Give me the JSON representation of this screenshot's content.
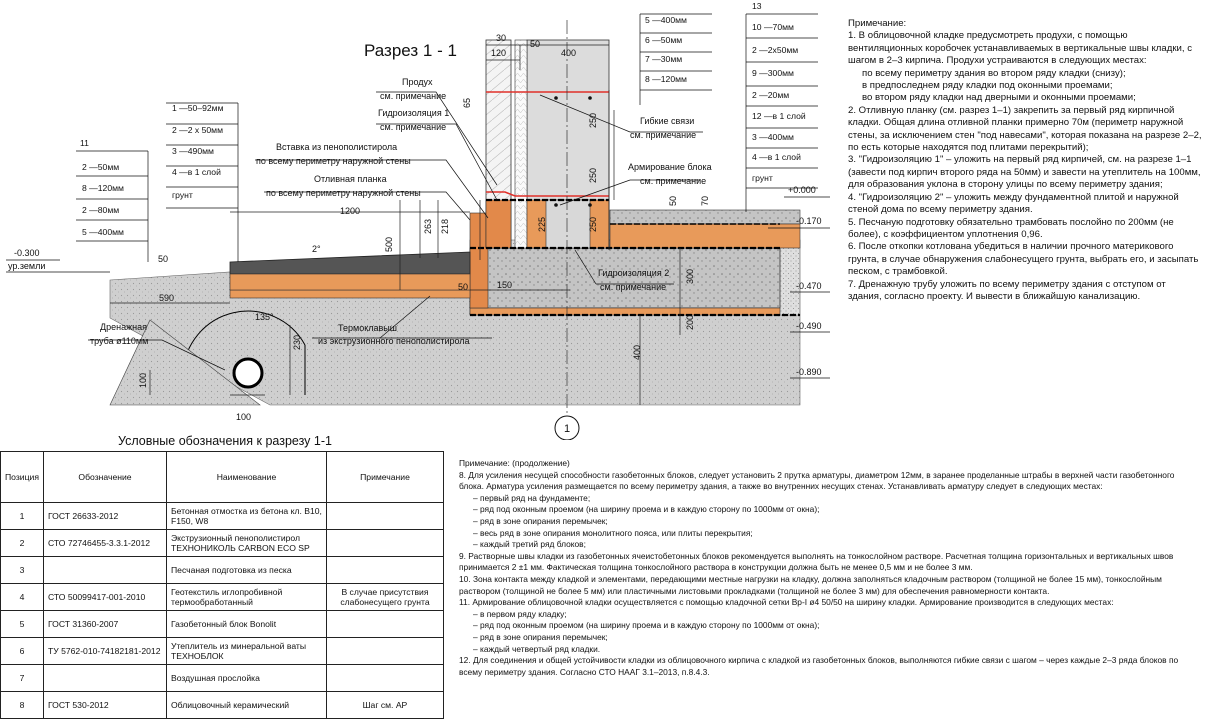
{
  "title": "Разрез 1 - 1",
  "axis_marker": "1",
  "layer_tables": {
    "left_top": [
      "1 —50–92мм",
      "2 —2 х 50мм",
      "3 —490мм",
      "4 —в 1 слой",
      "грунт"
    ],
    "left_num": "11",
    "left_bottom": [
      "2 —50мм",
      "8 —120мм",
      "2 —80мм",
      "5 —400мм"
    ],
    "top_center": [
      "5 —400мм",
      "6 —50мм",
      "7 —30мм",
      "8 —120мм"
    ],
    "right_num": "13",
    "right": [
      "10 —70мм",
      "2 —2х50мм",
      "9 —300мм",
      "2 —20мм",
      "12 —в 1 слой",
      "3 —400мм",
      "4 —в 1 слой",
      "грунт"
    ]
  },
  "elevations": {
    "ground": "-0.300",
    "ground_label": "ур.земли",
    "zero": "+0.000",
    "e170": "-0.170",
    "e470": "-0.470",
    "e490": "-0.490",
    "e890": "-0.890"
  },
  "callouts": {
    "produh": "Продух",
    "produh_sub": "см. примечание",
    "hydro1": "Гидроизоляция 1",
    "hydro1_sub": "см. примечание",
    "insert": "Вставка из пенополистирола",
    "insert_sub": "по всему периметру наружной стены",
    "planka": "Отливная планка",
    "planka_sub": "по всему периметру наружной стены",
    "ties": "Гибкие связи",
    "ties_sub": "см. примечание",
    "rebar": "Армирование блока",
    "rebar_sub": "см. примечание",
    "hydro2": "Гидроизоляция 2",
    "hydro2_sub": "см. примечание",
    "thermal": "Термоклавыш",
    "thermal_sub": "из экструзионного пенополистирола",
    "drain": "Дренажная",
    "drain_sub": "труба ø110мм"
  },
  "dims": {
    "d30": "30",
    "d120": "120",
    "d50a": "50",
    "d400a": "400",
    "d65": "65",
    "d250a": "250",
    "d250b": "250",
    "d70": "70",
    "d225": "225",
    "d250c": "250",
    "d1200": "1200",
    "d263": "263",
    "d218": "218",
    "d500": "500",
    "d2deg": "2°",
    "d50b": "50",
    "d50c": "50",
    "d590": "590",
    "d150": "150",
    "d50d": "50",
    "d300": "300",
    "d200": "200",
    "d135": "135°",
    "d400b": "400",
    "d100a": "100",
    "d100b": "100",
    "d230": "230"
  },
  "notes_right": {
    "title": "Примечание:",
    "p1": "1. В облицовочной кладке предусмотреть продухи, с помощью вентиляционных коробочек устанавливаемых в вертикальные швы кладки, с шагом в 2–3 кирпича. Продухи устраиваются в следующих местах:",
    "p1a": "по всему периметру здания во втором ряду кладки (снизу);",
    "p1b": "в предпоследнем ряду кладки под оконными проемами;",
    "p1c": "во втором ряду кладки над дверными и оконными проемами;",
    "p2": "2. Отливную планку (см. разрез 1–1) закрепить за первый ряд кирпичной кладки. Общая длина отливной планки примерно 70м (периметр наружной стены, за исключением стен \"под навесами\", которая показана на разрезе 2–2, по есть которые находятся под плитами перекрытий);",
    "p3": "3. \"Гидроизоляцию 1\" – уложить на первый ряд кирпичей, см. на разрезе 1–1 (завести под кирпич второго ряда на 50мм) и завести на утеплитель на 100мм, для образования уклона в сторону улицы по всему периметру здания;",
    "p4": "4. \"Гидроизоляцию 2\" – уложить между фундаментной плитой и наружной стеной дома по всему периметру здания.",
    "p5": "5. Песчаную подготовку обязательно трамбовать послойно по 200мм (не более), с коэффициентом уплотнения 0,96.",
    "p6": "6. После откопки котлована убедиться в наличии прочного материкового грунта, в случае обнаружения слабонесущего грунта, выбрать его, и засыпать песком, с трамбовкой.",
    "p7": "7. Дренажную трубу уложить по всему периметру здания с отступом от здания, согласно проекту. И вывести в ближайшую канализацию."
  },
  "notes_bottom": {
    "title": "Примечание: (продолжение)",
    "p8": "8. Для усиления несущей способности газобетонных блоков, следует установить 2 прутка арматуры, диаметром 12мм, в заранее проделанные штрабы в верхней части газобетонного блока. Арматура усиления размещается по всему периметру здания, а также во внутренних несущих стенах. Устанавливать арматуру следует в следующих местах:",
    "p8a": "– первый ряд на фундаменте;",
    "p8b": "– ряд под оконным проемом (на ширину проема и в каждую сторону по 1000мм от окна);",
    "p8c": "– ряд в зоне опирания перемычек;",
    "p8d": "– весь ряд в зоне опирания монолитного пояса, или плиты перекрытия;",
    "p8e": "– каждый третий ряд блоков;",
    "p9": "9. Растворные швы кладки из газобетонных ячеистобетонных блоков рекомендуется выполнять на тонкослойном растворе. Расчетная толщина горизонтальных и вертикальных швов принимается 2 ±1 мм. Фактическая толщина тонкослойного раствора в конструкции должна быть не менее 0,5 мм и не более 3 мм.",
    "p10": "10. Зона контакта между кладкой и элементами, передающими местные нагрузки на кладку, должна заполняться кладочным раствором (толщиной не более 15 мм), тонкослойным раствором (толщиной не более 5 мм) или пластичными листовыми прокладками (толщиной не более 3 мм) для обеспечения равномерности контакта.",
    "p11": "11. Армирование облицовочной кладки осуществляется с помощью кладочной сетки Вр-I ø4 50/50 на ширину кладки. Армирование производится в следующих местах:",
    "p11a": "– в первом ряду кладку;",
    "p11b": "– ряд под оконным проемом (на ширину проема и в каждую сторону по 1000мм от окна);",
    "p11c": "– ряд в зоне опирания перемычек;",
    "p11d": "– каждый четвертый ряд кладки.",
    "p12": "12. Для соединения и общей устойчивости кладки из облицовочного кирпича с кладкой из газобетонных блоков, выполняются гибкие связи с шагом – через каждые 2–3 ряда блоков по всему периметру здания. Согласно СТО НААГ 3.1–2013, п.8.4.3."
  },
  "legend": {
    "title": "Условные обозначения к разрезу 1-1",
    "headers": [
      "Позиция",
      "Обозначение",
      "Наименование",
      "Примечание"
    ],
    "rows": [
      [
        "1",
        "ГОСТ 26633-2012",
        "Бетонная отмостка из бетона кл. В10, F150, W8",
        ""
      ],
      [
        "2",
        "СТО 72746455-3.3.1-2012",
        "Экструзионный пенополистирол ТЕХНОНИКОЛЬ CARBON ECO SP",
        ""
      ],
      [
        "3",
        "",
        "Песчаная подготовка из песка",
        ""
      ],
      [
        "4",
        "СТО 50099417-001-2010",
        "Геотекстиль иглопробивной термообработанный",
        "В случае присутствия слабонесущего грунта"
      ],
      [
        "5",
        "ГОСТ 31360-2007",
        "Газобетонный блок Bonolit",
        ""
      ],
      [
        "6",
        "ТУ 5762-010-74182181-2012",
        "Утеплитель из минеральной ваты ТЕХНОБЛОК",
        ""
      ],
      [
        "7",
        "",
        "Воздушная прослойка",
        ""
      ],
      [
        "8",
        "ГОСТ 530-2012",
        "Облицовочный керамический",
        "Шаг см. АР"
      ]
    ]
  }
}
